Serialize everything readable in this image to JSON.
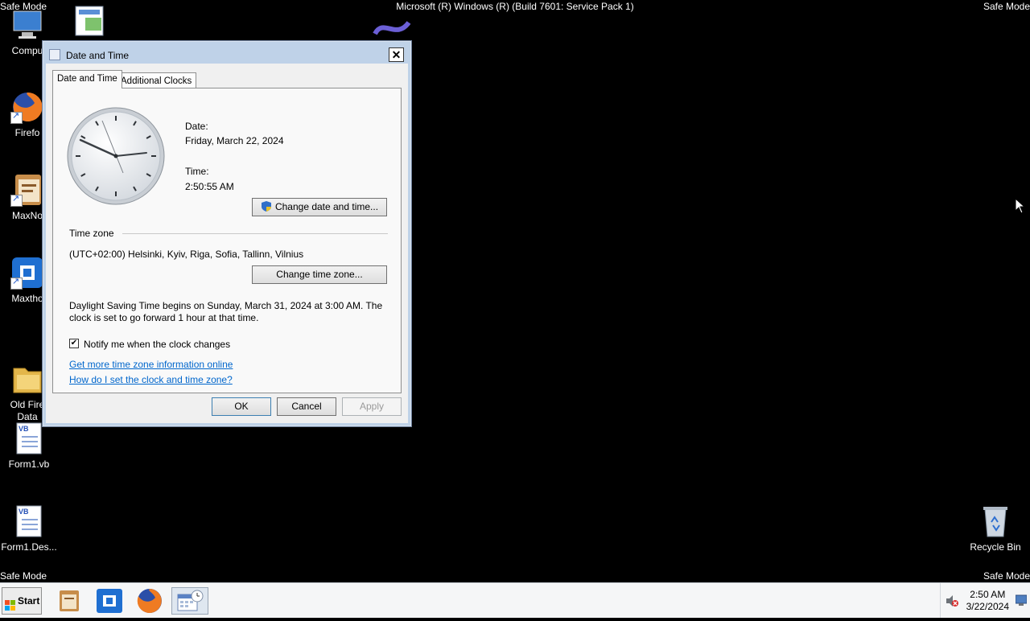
{
  "screen": {
    "banner": "Microsoft (R) Windows (R) (Build 7601: Service Pack 1)",
    "safe_mode": "Safe Mode"
  },
  "desktop_icons": [
    {
      "label": "Compu"
    },
    {
      "label": "Firefo"
    },
    {
      "label": "MaxNo"
    },
    {
      "label": "Maxtho"
    },
    {
      "label": "Old Fire\nData"
    },
    {
      "label": "Form1.vb"
    },
    {
      "label": "Form1.Des..."
    },
    {
      "label": "Recycle Bin"
    }
  ],
  "dialog": {
    "title": "Date and Time",
    "tabs": [
      "Date and Time",
      "Additional Clocks"
    ],
    "date_label": "Date:",
    "date_value": "Friday, March 22, 2024",
    "time_label": "Time:",
    "time_value": "2:50:55 AM",
    "change_datetime_button": "Change date and time...",
    "timezone_heading": "Time zone",
    "timezone_value": "(UTC+02:00) Helsinki, Kyiv, Riga, Sofia, Tallinn, Vilnius",
    "change_timezone_button": "Change time zone...",
    "dst_line1": "Daylight Saving Time begins on Sunday, March 31, 2024 at 3:00 AM. The",
    "dst_line2": "clock is set to go forward 1 hour at that time.",
    "notify_label": "Notify me when the clock changes",
    "notify_checked": true,
    "link_more_info": "Get more time zone information online",
    "link_how_to": "How do I set the clock and time zone?",
    "ok": "OK",
    "cancel": "Cancel",
    "apply": "Apply"
  },
  "taskbar": {
    "start": "Start",
    "clock_time": "2:50 AM",
    "clock_date": "3/22/2024"
  }
}
